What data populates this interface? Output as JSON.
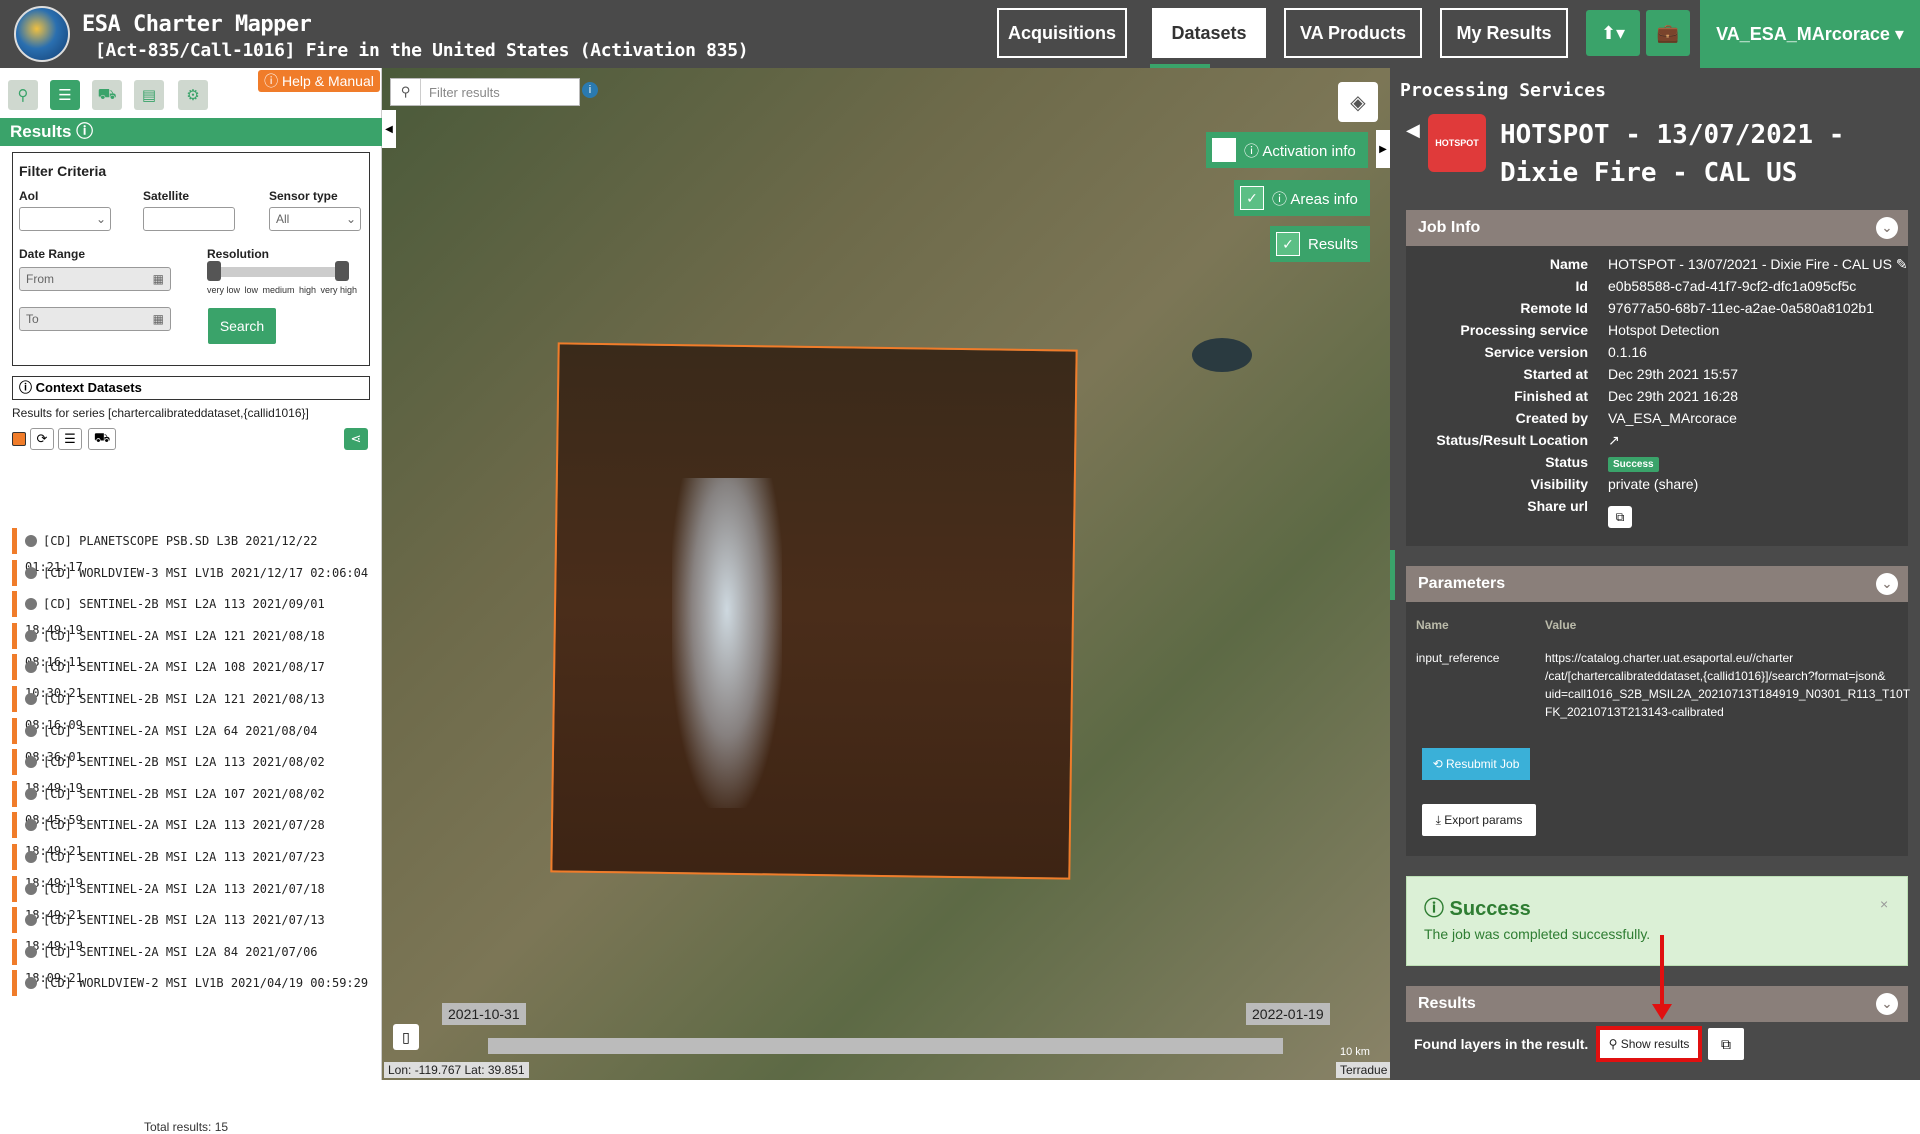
{
  "header": {
    "app_title": "ESA Charter Mapper",
    "activation_title": "[Act-835/Call-1016] Fire in the United States (Activation 835)",
    "nav": [
      "Acquisitions",
      "Datasets",
      "VA Products",
      "My Results"
    ],
    "user": "VA_ESA_MArcorace ▾",
    "upload_icon": "⬆▾",
    "briefcase_icon": "💼"
  },
  "left": {
    "help": "ⓘ Help & Manual",
    "results_header": "Results ⓘ",
    "filter_title": "Filter Criteria",
    "aoi_label": "AoI",
    "satellite_label": "Satellite",
    "sensor_label": "Sensor type",
    "sensor_value": "All",
    "date_range_label": "Date Range",
    "from_placeholder": "From",
    "to_placeholder": "To",
    "resolution_label": "Resolution",
    "res_ticks": [
      "very low",
      "low",
      "medium",
      "high",
      "very high"
    ],
    "search_button": "Search",
    "context_datasets": "ⓘ Context Datasets",
    "series_text": "Results for series [chartercalibrateddataset,{callid1016}]",
    "items": [
      "[CD] PLANETSCOPE PSB.SD L3B 2021/12/22 01:21:17",
      "[CD] WORLDVIEW-3 MSI LV1B 2021/12/17 02:06:04",
      "[CD] SENTINEL-2B MSI L2A 113 2021/09/01 18:49:19",
      "[CD] SENTINEL-2A MSI L2A 121 2021/08/18 08:16:11",
      "[CD] SENTINEL-2A MSI L2A 108 2021/08/17 10:30:21",
      "[CD] SENTINEL-2B MSI L2A 121 2021/08/13 08:16:09",
      "[CD] SENTINEL-2A MSI L2A 64 2021/08/04 08:36:01",
      "[CD] SENTINEL-2B MSI L2A 113 2021/08/02 18:49:19",
      "[CD] SENTINEL-2B MSI L2A 107 2021/08/02 08:45:59",
      "[CD] SENTINEL-2A MSI L2A 113 2021/07/28 18:49:21",
      "[CD] SENTINEL-2B MSI L2A 113 2021/07/23 18:49:19",
      "[CD] SENTINEL-2A MSI L2A 113 2021/07/18 18:49:21",
      "[CD] SENTINEL-2B MSI L2A 113 2021/07/13 18:49:19",
      "[CD] SENTINEL-2A MSI L2A 84 2021/07/06 18:09:21",
      "[CD] WORLDVIEW-2 MSI LV1B 2021/04/19 00:59:29"
    ],
    "total": "Total results: 15"
  },
  "map": {
    "filter_placeholder": "Filter results",
    "activation_info": "ⓘ Activation info",
    "areas_info": "ⓘ Areas info",
    "results": "Results",
    "date_start": "2021-10-31",
    "date_end": "2022-01-19",
    "coords": "Lon: -119.767 Lat: 39.851",
    "scale": "10 km",
    "credit": "Terradue"
  },
  "right": {
    "panel_title": "Processing Services",
    "service_icon_label": "HOTSPOT",
    "job_title": "HOTSPOT - 13/07/2021 - Dixie Fire - CAL US",
    "job_info_header": "Job Info",
    "job_info": [
      {
        "k": "Name",
        "v": "HOTSPOT - 13/07/2021 - Dixie Fire - CAL US ✎"
      },
      {
        "k": "Id",
        "v": "e0b58588-c7ad-41f7-9cf2-dfc1a095cf5c"
      },
      {
        "k": "Remote Id",
        "v": "97677a50-68b7-11ec-a2ae-0a580a8102b1"
      },
      {
        "k": "Processing service",
        "v": "Hotspot Detection"
      },
      {
        "k": "Service version",
        "v": "0.1.16"
      },
      {
        "k": "Started at",
        "v": "Dec 29th 2021 15:57"
      },
      {
        "k": "Finished at",
        "v": "Dec 29th 2021 16:28"
      },
      {
        "k": "Created by",
        "v": "VA_ESA_MArcorace"
      },
      {
        "k": "Status/Result Location",
        "v": "↗"
      },
      {
        "k": "Status",
        "v": "Success"
      },
      {
        "k": "Visibility",
        "v": "private (share)"
      },
      {
        "k": "Share url",
        "v": ""
      }
    ],
    "parameters_header": "Parameters",
    "param_name_col": "Name",
    "param_value_col": "Value",
    "param_name": "input_reference",
    "param_value_lines": [
      "https://catalog.charter.uat.esaportal.eu//charter",
      "/cat/[chartercalibrateddataset,{callid1016}]/search?format=json&",
      "uid=call1016_S2B_MSIL2A_20210713T184919_N0301_R113_T10T",
      "FK_20210713T213143-calibrated"
    ],
    "resubmit": "⟲ Resubmit Job",
    "export": "⤓ Export params",
    "alert_title": "ⓘ Success",
    "alert_msg": "The job was completed successfully.",
    "alert_close": "×",
    "results_header": "Results",
    "found_layers": "Found layers in the result.",
    "show_results": "⚲ Show results",
    "copy_icon": "⧉"
  }
}
